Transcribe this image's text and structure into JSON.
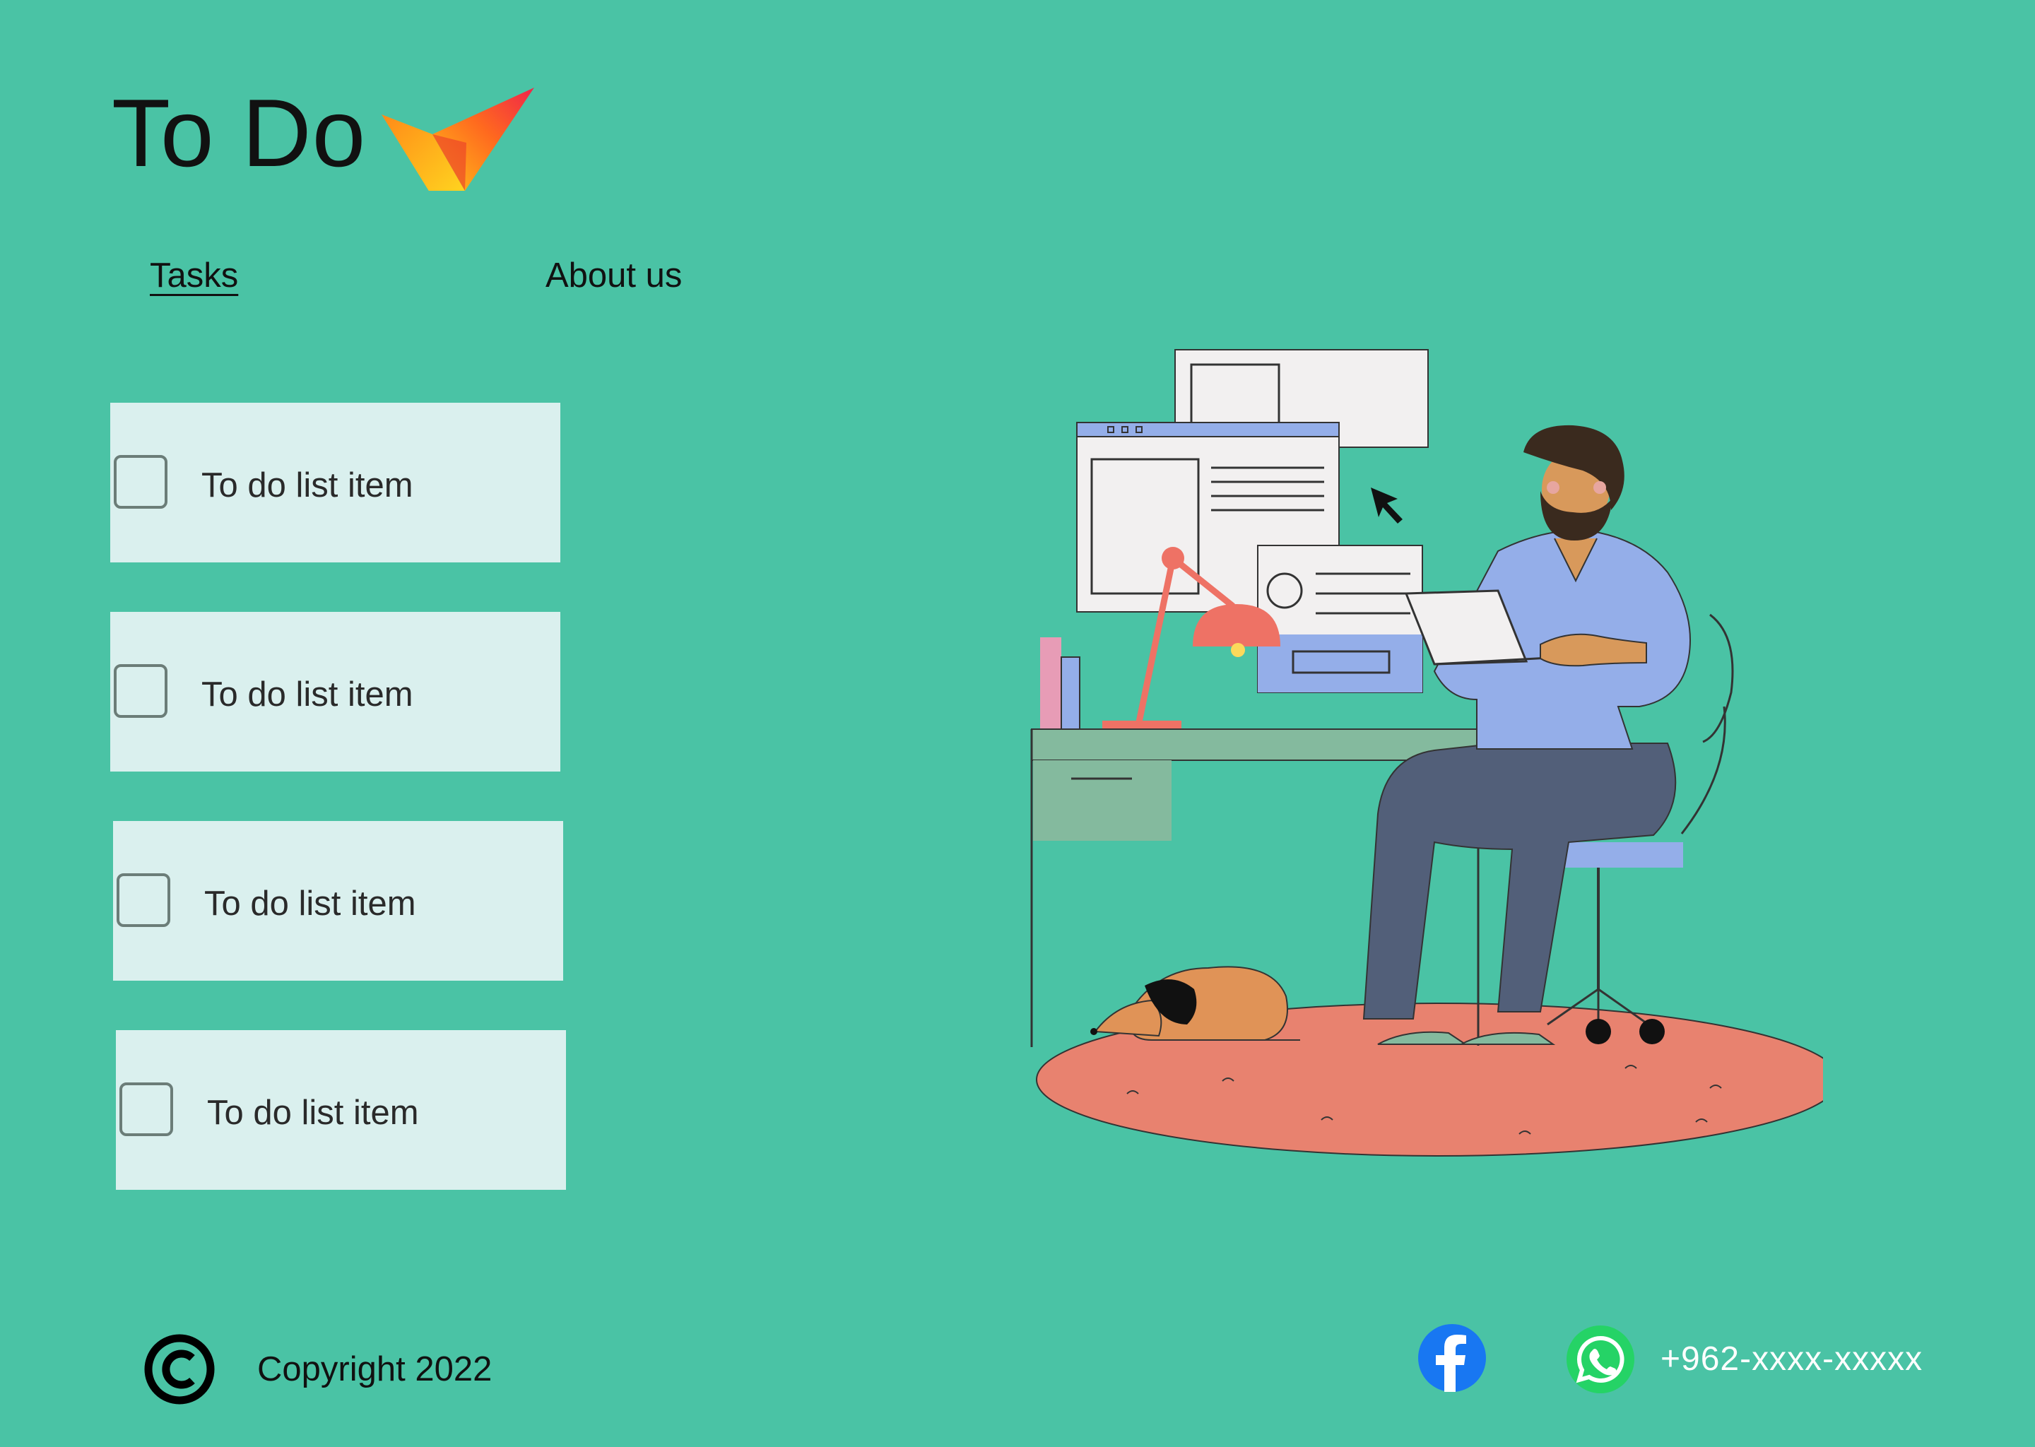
{
  "header": {
    "title": "To Do",
    "logo_icon": "checkmark-logo-icon"
  },
  "nav": {
    "tasks_label": "Tasks",
    "about_label": "About us",
    "active": "Tasks"
  },
  "todo_list": {
    "items": [
      {
        "label": "To do list item",
        "checked": false
      },
      {
        "label": "To do list item",
        "checked": false
      },
      {
        "label": "To do list item",
        "checked": false
      },
      {
        "label": "To do list item",
        "checked": false
      }
    ]
  },
  "illustration": {
    "icon": "person-working-at-desk-illustration"
  },
  "footer": {
    "copyright_icon": "copyright-icon",
    "copyright_text": "Copyright 2022",
    "facebook_icon": "facebook-icon",
    "whatsapp_icon": "whatsapp-icon",
    "phone": "+962-xxxx-xxxxx"
  },
  "colors": {
    "background": "#4AC3A5",
    "card": "#DAF0EE",
    "rug": "#E8826F",
    "shirt": "#94AEE9",
    "pants": "#525F79",
    "lamp": "#EE7265",
    "facebook": "#1877F2",
    "whatsapp": "#25D366"
  }
}
